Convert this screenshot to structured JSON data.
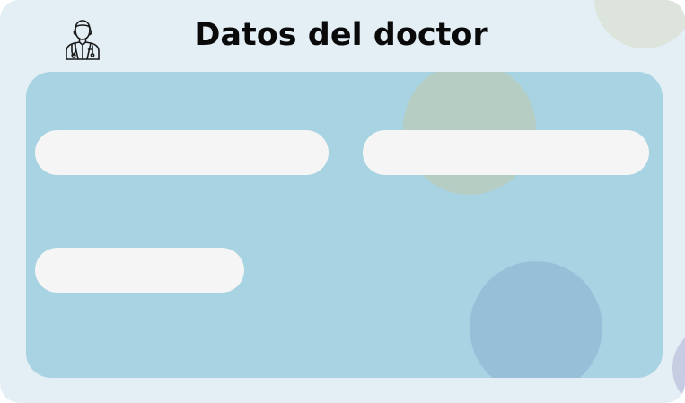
{
  "header": {
    "title": "Datos del doctor",
    "icon": "doctor-icon"
  },
  "form": {
    "fields": [
      {
        "value": "",
        "placeholder": ""
      },
      {
        "value": "",
        "placeholder": ""
      },
      {
        "value": "",
        "placeholder": ""
      }
    ]
  },
  "colors": {
    "background": "#e3eff5",
    "panel": "#a7d3e2",
    "field": "#f5f5f5",
    "title": "#0a0a0a"
  }
}
